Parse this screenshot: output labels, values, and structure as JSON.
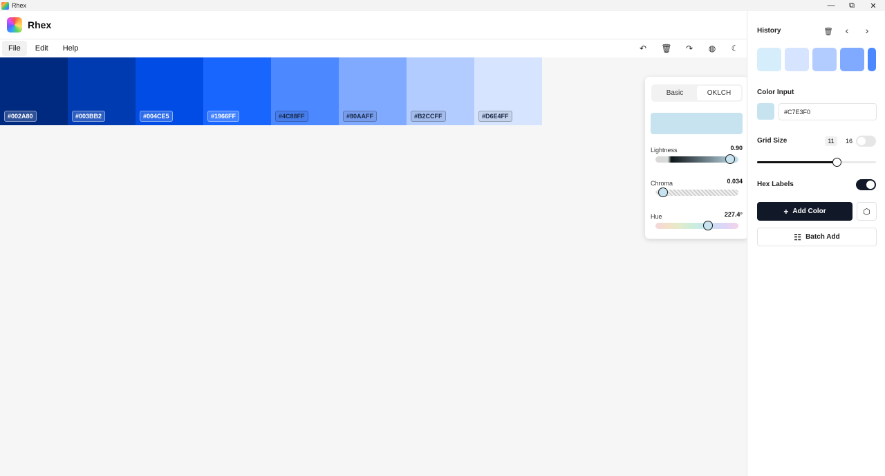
{
  "window": {
    "title": "Rhex",
    "controls": {
      "minimize": "—",
      "restore": "⧉",
      "close": "✕"
    }
  },
  "app": {
    "name": "Rhex"
  },
  "menu": [
    "File",
    "Edit",
    "Help"
  ],
  "toolbar": {
    "undo_icon": "↶",
    "delete_icon": "🗑",
    "redo_icon": "↷",
    "globe_icon": "◍",
    "theme_icon": "☾"
  },
  "swatches": [
    {
      "hex": "#002A80",
      "color": "#002A80",
      "label_style": "light"
    },
    {
      "hex": "#003BB2",
      "color": "#003BB2",
      "label_style": "light"
    },
    {
      "hex": "#004CE5",
      "color": "#004CE5",
      "label_style": "light"
    },
    {
      "hex": "#1966FF",
      "color": "#1966FF",
      "label_style": "light"
    },
    {
      "hex": "#4C88FF",
      "color": "#4C88FF",
      "label_style": "dark"
    },
    {
      "hex": "#80AAFF",
      "color": "#80AAFF",
      "label_style": "dark"
    },
    {
      "hex": "#B2CCFF",
      "color": "#B2CCFF",
      "label_style": "dark"
    },
    {
      "hex": "#D6E4FF",
      "color": "#D6E4FF",
      "label_style": "dark"
    }
  ],
  "picker": {
    "tabs": [
      "Basic",
      "OKLCH"
    ],
    "active_tab": "OKLCH",
    "preview_color": "#C7E3F0",
    "sliders": [
      {
        "label": "Lightness",
        "value": "0.90",
        "fraction": 0.9
      },
      {
        "label": "Chroma",
        "value": "0.034",
        "fraction": 0.09
      },
      {
        "label": "Hue",
        "value": "227.4°",
        "fraction": 0.632
      }
    ]
  },
  "sidebar": {
    "history": {
      "title": "History",
      "trash_icon": "🗑",
      "prev_icon": "‹",
      "next_icon": "›",
      "colors": [
        "#D6EEFB",
        "#D6E4FF",
        "#B2CCFF",
        "#80AAFF",
        "#4C88FF"
      ]
    },
    "color_input": {
      "title": "Color Input",
      "value": "#C7E3F0",
      "chip_color": "#C7E3F0"
    },
    "grid_size": {
      "title": "Grid Size",
      "options": [
        "11",
        "16"
      ],
      "selected": "11",
      "toggle_on": false,
      "slider_fraction": 0.67
    },
    "hex_labels": {
      "title": "Hex Labels",
      "toggle_on": true
    },
    "add_color": {
      "label": "Add Color",
      "plus_icon": "+"
    },
    "cube_icon": "⬡",
    "batch_add": {
      "label": "Batch Add",
      "icon": "☷"
    }
  }
}
